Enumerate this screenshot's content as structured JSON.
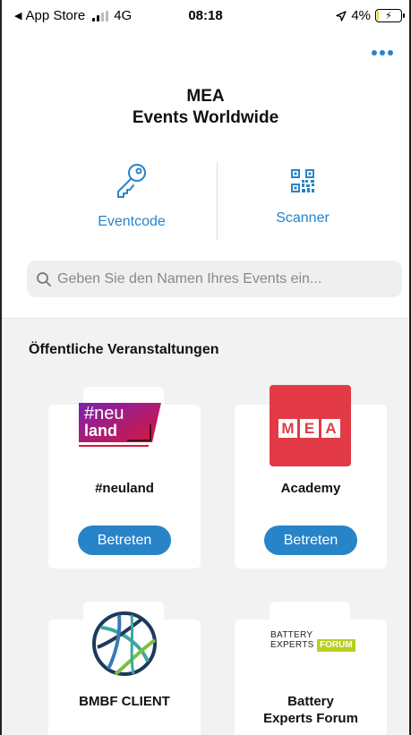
{
  "status_bar": {
    "back_app": "App Store",
    "network": "4G",
    "time": "08:18",
    "battery": "4%",
    "battery_level": 0.04
  },
  "header": {
    "title_line1": "MEA",
    "title_line2": "Events Worldwide"
  },
  "actions": {
    "eventcode_label": "Eventcode",
    "scanner_label": "Scanner"
  },
  "search": {
    "placeholder": "Geben Sie den Namen Ihres Events ein..."
  },
  "section_title": "Öffentliche Veranstaltungen",
  "events": [
    {
      "name": "#neuland",
      "button": "Betreten",
      "logo_text_1": "#neu",
      "logo_text_2": "land"
    },
    {
      "name": "Academy",
      "button": "Betreten",
      "logo_letters": [
        "M",
        "E",
        "A"
      ]
    },
    {
      "name": "BMBF CLIENT"
    },
    {
      "name_line1": "Battery",
      "name_line2": "Experts Forum",
      "logo_text_1": "BATTERY",
      "logo_text_2": "EXPERTS",
      "logo_text_3": "FORUM"
    }
  ],
  "colors": {
    "accent": "#2784c9",
    "mea_red": "#e23a46",
    "neuland_purple": "#6a1fa0",
    "neuland_red": "#d4183a",
    "bef_green": "#b7cf1e"
  }
}
